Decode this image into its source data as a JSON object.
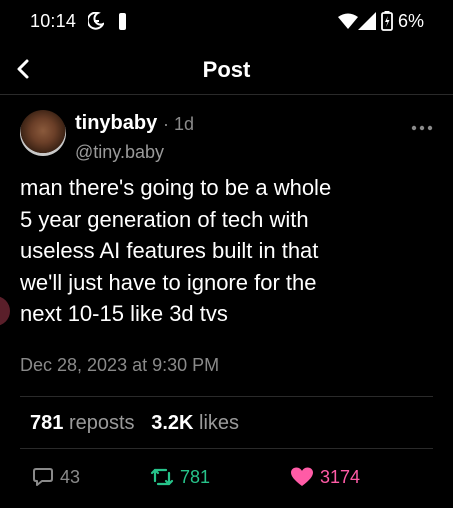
{
  "status_bar": {
    "time": "10:14",
    "battery": "6%"
  },
  "nav": {
    "title": "Post"
  },
  "post": {
    "username": "tinybaby",
    "age": "· 1d",
    "handle": "@tiny.baby",
    "text_lines": [
      "man there's going to be a whole",
      "5 year generation of tech with",
      "useless AI features built in that",
      "we'll just have to ignore for the",
      "next 10-15 like 3d tvs"
    ],
    "timestamp": "Dec 28, 2023 at 9:30 PM"
  },
  "stats": {
    "reposts_count": "781",
    "reposts_label": "reposts",
    "likes_count": "3.2K",
    "likes_label": "likes"
  },
  "actions": {
    "reply_count": "43",
    "repost_count": "781",
    "like_count": "3174"
  },
  "colors": {
    "background": "#000000",
    "repost": "#27c38a",
    "like": "#ff5ba6",
    "muted": "#8a8a8a"
  }
}
